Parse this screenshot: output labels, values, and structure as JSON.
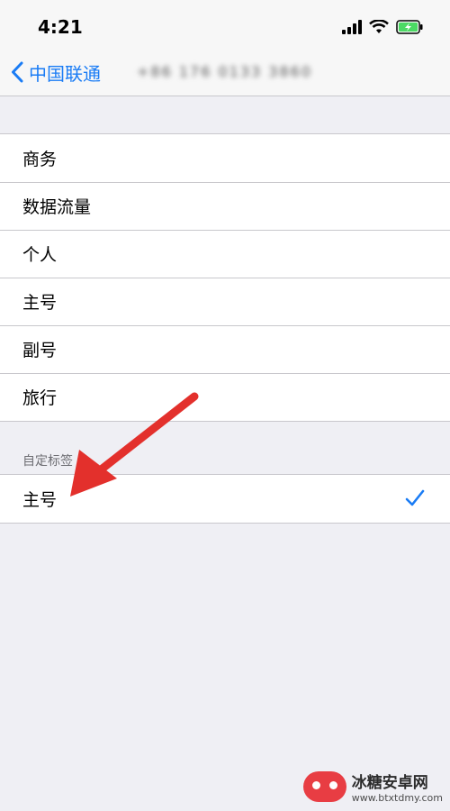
{
  "status_bar": {
    "time": "4:21",
    "icons": [
      "cellular-signal-icon",
      "wifi-icon",
      "battery-charging-icon"
    ],
    "battery_color": "#4cd964"
  },
  "nav": {
    "back_label": "中国联通",
    "title_blurred": "+86 176 0133 3860"
  },
  "labels_list": [
    {
      "label": "商务"
    },
    {
      "label": "数据流量"
    },
    {
      "label": "个人"
    },
    {
      "label": "主号"
    },
    {
      "label": "副号"
    },
    {
      "label": "旅行"
    }
  ],
  "custom_section": {
    "header": "自定标签",
    "rows": [
      {
        "label": "主号",
        "selected": true
      }
    ]
  },
  "annotation": {
    "type": "arrow",
    "color": "#e3302c"
  },
  "watermark": {
    "title": "冰糖安卓网",
    "url": "www.btxtdmy.com"
  },
  "colors": {
    "accent": "#1a7cf5",
    "background": "#efeff4",
    "separator": "#c8c7cc"
  }
}
